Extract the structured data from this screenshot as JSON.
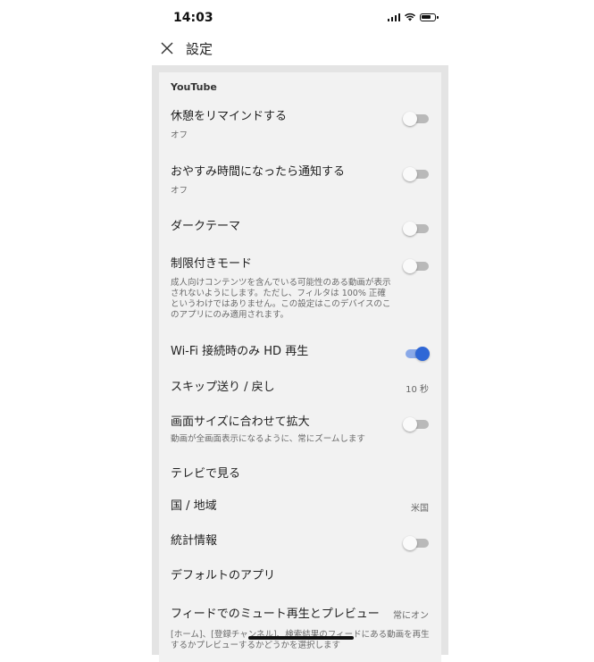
{
  "status_bar": {
    "time": "14:03"
  },
  "header": {
    "title": "設定"
  },
  "section": {
    "title": "YouTube"
  },
  "settings": [
    {
      "title": "休憩をリマインドする",
      "subtitle": "オフ",
      "toggle": false
    },
    {
      "title": "おやすみ時間になったら通知する",
      "subtitle": "オフ",
      "toggle": false
    },
    {
      "title": "ダークテーマ",
      "toggle": false
    },
    {
      "title": "制限付きモード",
      "subtitle": "成人向けコンテンツを含んでいる可能性のある動画が表示されないようにします。ただし、フィルタは 100% 正確というわけではありません。この設定はこのデバイスのこのアプリにのみ適用されます。",
      "toggle": false
    },
    {
      "title": "Wi-Fi 接続時のみ HD 再生",
      "toggle": true
    },
    {
      "title": "スキップ送り / 戻し",
      "value": "10 秒"
    },
    {
      "title": "画面サイズに合わせて拡大",
      "subtitle": "動画が全画面表示になるように、常にズームします",
      "toggle": false
    },
    {
      "title": "テレビで見る"
    },
    {
      "title": "国 / 地域",
      "value": "米国"
    },
    {
      "title": "統計情報",
      "toggle": false
    },
    {
      "title": "デフォルトのアプリ"
    },
    {
      "title": "フィードでのミュート再生とプレビュー",
      "value": "常にオン",
      "subtitle": "[ホーム]、[登録チャンネル]、検索結果のフィードにある動画を再生するかプレビューするかどうかを選択します"
    }
  ],
  "colors": {
    "toggle_on": "#2f67d6",
    "toggle_off": "#b9b9b9",
    "panel_bg": "#f2f2f2"
  }
}
